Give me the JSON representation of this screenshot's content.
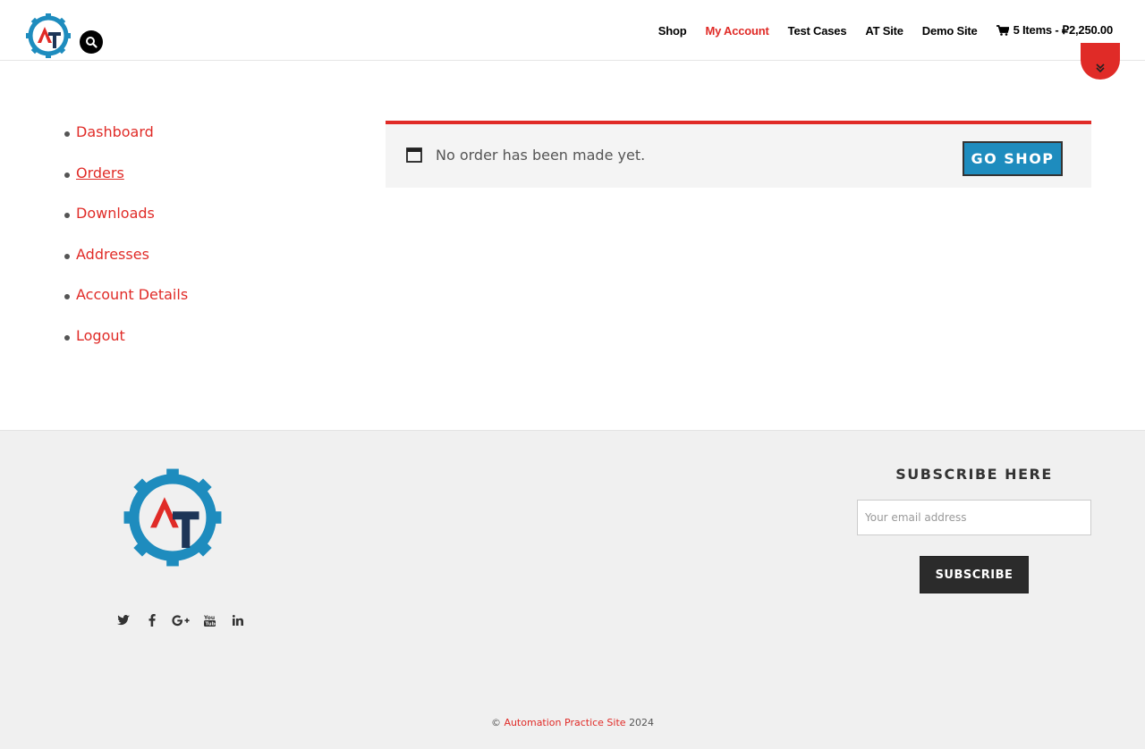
{
  "header": {
    "nav": [
      {
        "label": "Shop",
        "active": false
      },
      {
        "label": "My Account",
        "active": true
      },
      {
        "label": "Test Cases",
        "active": false
      },
      {
        "label": "AT Site",
        "active": false
      },
      {
        "label": "Demo Site",
        "active": false
      }
    ],
    "cart_label": "5 Items - ₽2,250.00"
  },
  "account_nav": [
    {
      "label": "Dashboard",
      "current": false
    },
    {
      "label": "Orders",
      "current": true
    },
    {
      "label": "Downloads",
      "current": false
    },
    {
      "label": "Addresses",
      "current": false
    },
    {
      "label": "Account Details",
      "current": false
    },
    {
      "label": "Logout",
      "current": false
    }
  ],
  "notice": {
    "message": "No order has been made yet.",
    "button_label": "GO SHOP"
  },
  "footer": {
    "subscribe_title": "SUBSCRIBE HERE",
    "email_placeholder": "Your email address",
    "subscribe_button": "SUBSCRIBE",
    "copyright_symbol": "©",
    "copyright_link": "Automation Practice Site",
    "copyright_year": "2024"
  },
  "colors": {
    "accent": "#e02b27",
    "button_blue": "#1e8cbe",
    "logo_blue": "#1e8cbe",
    "logo_red": "#e02b27",
    "logo_dark": "#1d3557"
  },
  "icons": [
    "search-icon",
    "chevron-double-down-icon",
    "cart-icon",
    "calendar-icon",
    "twitter-icon",
    "facebook-icon",
    "google-plus-icon",
    "youtube-icon",
    "linkedin-icon"
  ]
}
